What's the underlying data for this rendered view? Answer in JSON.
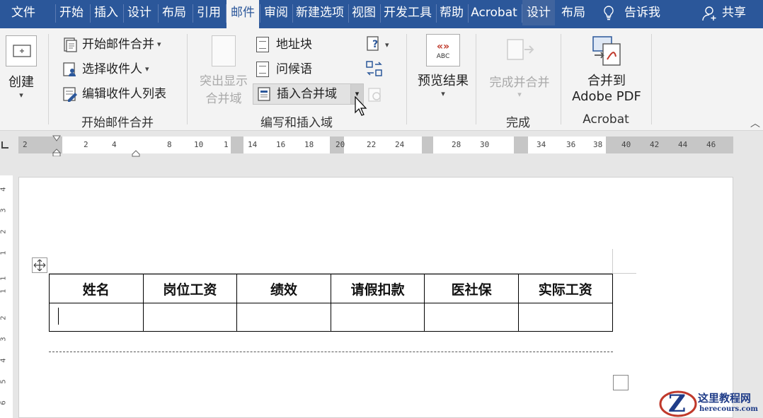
{
  "tabs": [
    {
      "label": "文件",
      "ctx": false,
      "active": false
    },
    {
      "label": "开始",
      "ctx": false,
      "active": false
    },
    {
      "label": "插入",
      "ctx": false,
      "active": false
    },
    {
      "label": "设计",
      "ctx": false,
      "active": false
    },
    {
      "label": "布局",
      "ctx": false,
      "active": false
    },
    {
      "label": "引用",
      "ctx": false,
      "active": false
    },
    {
      "label": "邮件",
      "ctx": false,
      "active": true
    },
    {
      "label": "审阅",
      "ctx": false,
      "active": false
    },
    {
      "label": "新建选项",
      "ctx": false,
      "active": false
    },
    {
      "label": "视图",
      "ctx": false,
      "active": false
    },
    {
      "label": "开发工具",
      "ctx": false,
      "active": false
    },
    {
      "label": "帮助",
      "ctx": false,
      "active": false
    },
    {
      "label": "Acrobat",
      "ctx": false,
      "active": false
    },
    {
      "label": "设计",
      "ctx": true,
      "active": false
    },
    {
      "label": "布局",
      "ctx": false,
      "active": false
    }
  ],
  "tellme": "告诉我",
  "share": "共享",
  "ribbon": {
    "create": {
      "label": "创建"
    },
    "start_group": {
      "start_merge": "开始邮件合并",
      "select_recipients": "选择收件人",
      "edit_list": "编辑收件人列表",
      "label": "开始邮件合并"
    },
    "write_group": {
      "highlight_line1": "突出显示",
      "highlight_line2": "合并域",
      "address_block": "地址块",
      "greeting": "问候语",
      "insert_field": "插入合并域",
      "label": "编写和插入域"
    },
    "preview": {
      "label": "预览结果",
      "icon_text": "ABC",
      "icon_top": "«»"
    },
    "finish_group": {
      "finish_merge": "完成并合并",
      "label": "完成"
    },
    "acrobat_group": {
      "line1": "合并到",
      "line2": "Adobe PDF",
      "label": "Acrobat"
    }
  },
  "ruler": {
    "ticks": [
      "2",
      "2",
      "4",
      "8",
      "10",
      "1",
      "14",
      "16",
      "18",
      "20",
      "22",
      "24",
      "28",
      "30",
      "34",
      "36",
      "38",
      "40",
      "42",
      "44",
      "46"
    ]
  },
  "vruler": {
    "ticks": [
      "4",
      "3",
      "2",
      "1",
      "1",
      "1",
      "2",
      "3",
      "4",
      "5",
      "6"
    ]
  },
  "table": {
    "headers": [
      "姓名",
      "岗位工资",
      "绩效",
      "请假扣款",
      "医社保",
      "实际工资"
    ]
  },
  "watermark": {
    "name": "这里教程网",
    "url": "herecours.com"
  },
  "colors": {
    "brand": "#2b579a",
    "ribbon": "#f3f3f3"
  }
}
